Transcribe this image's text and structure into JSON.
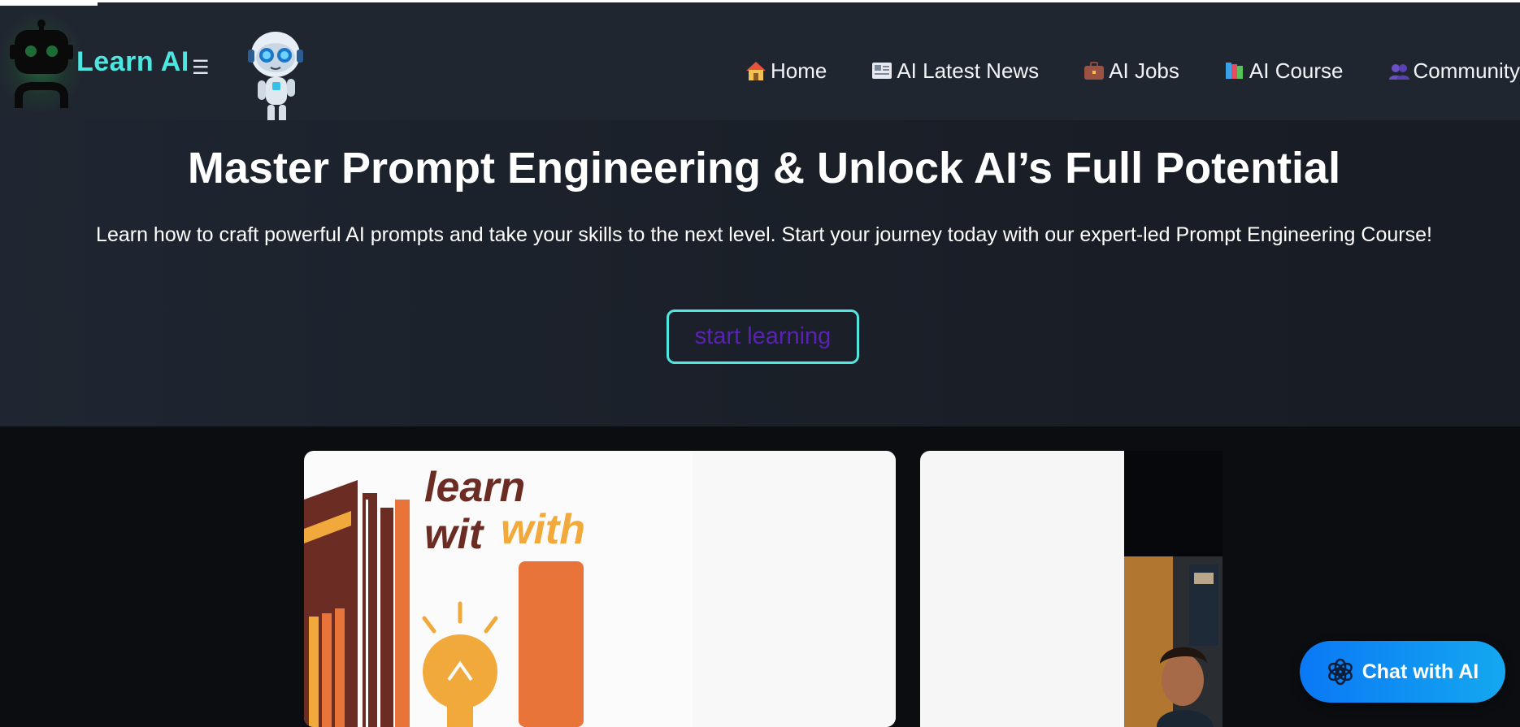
{
  "header": {
    "brand": "Learn AI",
    "menu_glyph": "☰",
    "nav": [
      {
        "label": "Home",
        "icon": "house-icon"
      },
      {
        "label": "AI Latest News",
        "icon": "newspaper-icon"
      },
      {
        "label": "AI Jobs",
        "icon": "briefcase-icon"
      },
      {
        "label": "AI Course",
        "icon": "books-icon"
      },
      {
        "label": "Community",
        "icon": "people-icon"
      }
    ]
  },
  "hero": {
    "title": "Master Prompt Engineering & Unlock AI’s Full Potential",
    "subtitle": "Learn how to craft powerful AI prompts and take your skills to the next level. Start your journey today with our expert-led Prompt Engineering Course!",
    "cta_label": "start learning"
  },
  "cards": {
    "card1_art_line1": "learn",
    "card1_art_line2a": "wit",
    "card1_art_line2b": "with"
  },
  "chat": {
    "label": "Chat with AI"
  },
  "colors": {
    "brand_accent": "#4ee6e0",
    "cta_text": "#5b21b6",
    "chat_button": "#0a78f5"
  }
}
